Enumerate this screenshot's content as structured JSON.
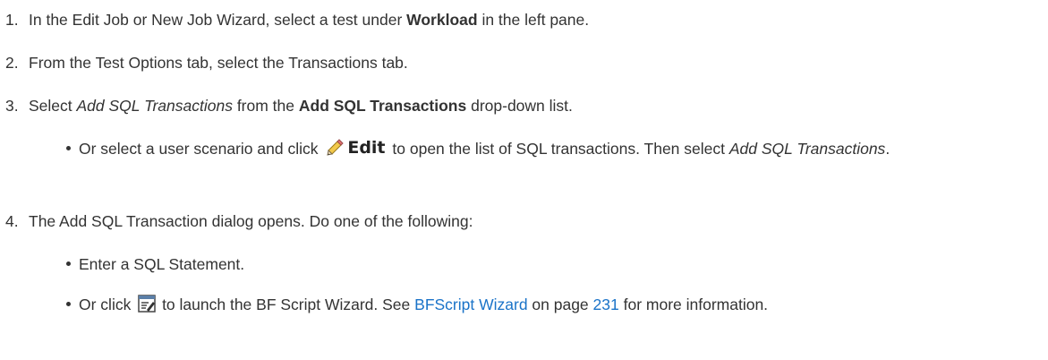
{
  "steps": [
    {
      "number": "1.",
      "text_a": "In the Edit Job or New Job Wizard, select a test under ",
      "bold": "Workload",
      "text_b": " in the left pane."
    },
    {
      "number": "2.",
      "text": "From the Test Options tab, select the Transactions tab."
    },
    {
      "number": "3.",
      "text_a": "Select ",
      "italic": "Add SQL Transactions",
      "text_b": " from the ",
      "bold": "Add SQL Transactions",
      "text_c": " drop-down list.",
      "bullet": {
        "text_a": "Or select a user scenario and click ",
        "button_label": "Edit",
        "button_icon": "pencil-icon",
        "text_b": " to open the list of SQL transactions. Then select ",
        "italic": "Add SQL Transactions",
        "text_c": "."
      }
    },
    {
      "number": "4.",
      "text": "The Add SQL Transaction dialog opens. Do one of the following:",
      "bullets": [
        {
          "text": "Enter a SQL Statement."
        },
        {
          "text_a": "Or click ",
          "icon": "script-wizard-icon",
          "text_b": " to launch the BF Script Wizard. See ",
          "link_text": "BFScript Wizard",
          "text_c": " on page ",
          "page_link": "231",
          "text_d": " for more information."
        }
      ]
    }
  ],
  "colors": {
    "text": "#333333",
    "link": "#1a73c8"
  }
}
